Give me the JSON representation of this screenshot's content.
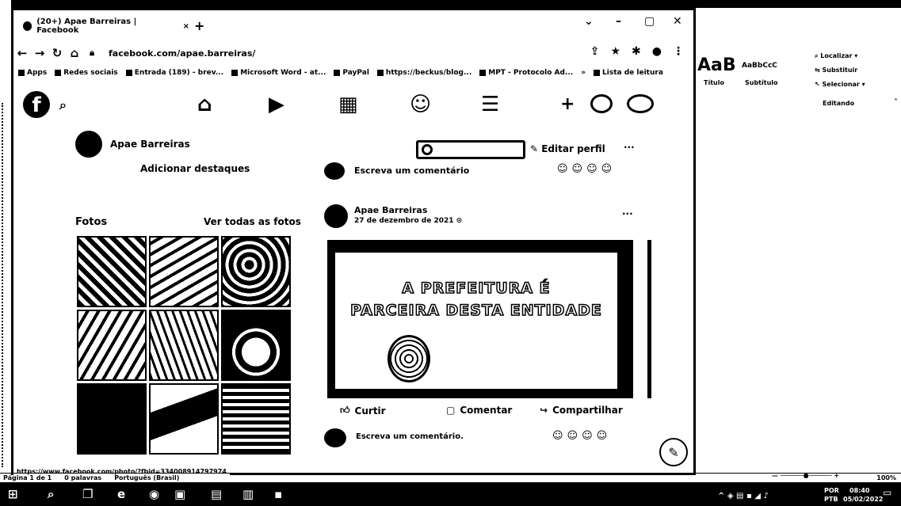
{
  "browser": {
    "tab_title": "(20+) Apae Barreiras | Facebook",
    "tab_close": "×",
    "new_tab": "+",
    "win_min": "–",
    "win_max": "▢",
    "win_close": "✕",
    "win_dropdown": "⌄",
    "url": "facebook.com/apae.barreiras/",
    "bookmarks": [
      "Apps",
      "Redes sociais",
      "Entrada (189) - brev...",
      "Microsoft Word - at...",
      "PayPal",
      "https://beckus/blog...",
      "MPT - Protocolo Ad...",
      "»",
      "Lista de leitura"
    ],
    "status_url": "https://www.facebook.com/photo/?fbid=334008914797974"
  },
  "page": {
    "name": "Apae Barreiras",
    "add_highlights": "Adicionar destaques",
    "edit_profile": "Editar perfil",
    "more": "···",
    "photos_title": "Fotos",
    "see_all_photos": "Ver todas as fotos",
    "write_comment": "Escreva um comentário",
    "write_comment_2": "Escreva um comentário.",
    "post_author": "Apae Barreiras",
    "post_date": "27 de dezembro de 2021",
    "post_line1": "A PREFEITURA É",
    "post_line2": "PARCEIRA DESTA ENTIDADE",
    "like": "Curtir",
    "comment": "Comentar",
    "share": "Compartilhar",
    "reactions": "☺☺☺☺"
  },
  "word": {
    "style_1": "AaB",
    "style_2": "AaBbCcC",
    "style_1_label": "Título",
    "style_2_label": "Subtítulo",
    "find": "Localizar",
    "replace": "Substituir",
    "select": "Selecionar",
    "editing": "Editando",
    "status_page": "Página 1 de 1",
    "status_words": "0 palavras",
    "status_lang": "Português (Brasil)",
    "zoom": "100%"
  },
  "taskbar": {
    "lang": "POR",
    "lang2": "PTB",
    "time": "08:40",
    "date": "05/02/2022"
  }
}
